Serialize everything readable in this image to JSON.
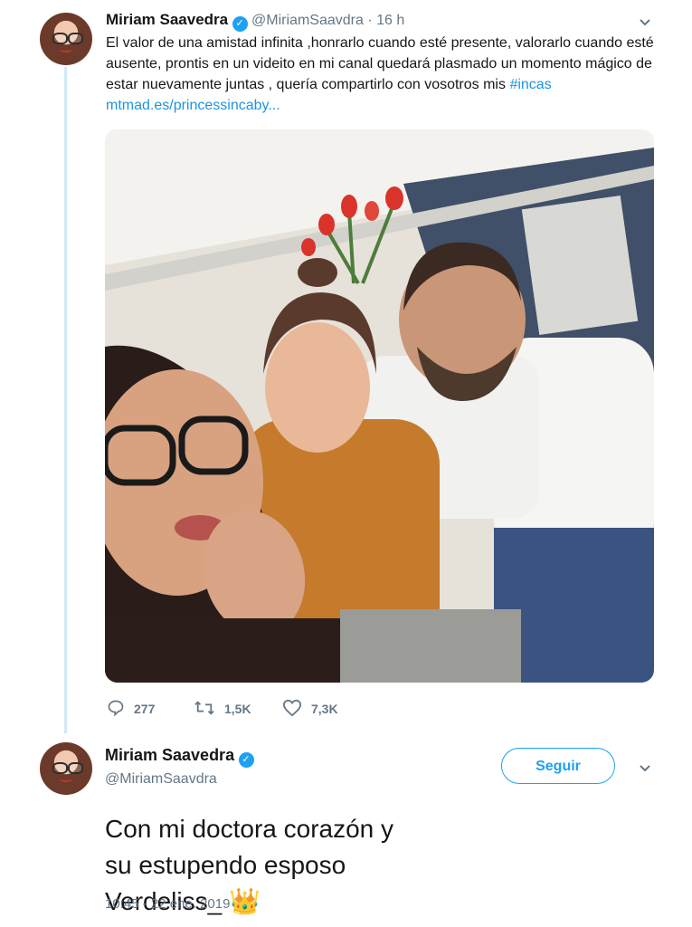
{
  "reply_tweet": {
    "name": "Miriam Saavedra",
    "handle_time": "@MiriamSaavdra · 16 h",
    "text_plain": "El valor de una amistad infinita ,honrarlo cuando esté presente, valorarlo cuando esté ausente, prontis en un videito en mi canal quedará plasmado un momento mágico de estar nuevamente juntas , quería compartirlo con vosotros mis ",
    "hashtag": "#incas",
    "link": "mtmad.es/princessincaby...",
    "replies": "277",
    "retweets": "1,5K",
    "likes": "7,3K"
  },
  "main_tweet": {
    "name": "Miriam Saavedra",
    "handle": "@MiriamSaavdra",
    "follow_label": "Seguir",
    "text": "Con mi doctora corazón y su estupendo esposo Verdeliss_",
    "emoji": "👑",
    "timestamp": "10:45 - 22 ene. 2019"
  },
  "colors": {
    "accent": "#1da1f2",
    "link": "#1b95e0",
    "muted": "#657786",
    "thread_line": "#cfe9f5"
  },
  "icons": [
    "verified-badge-icon",
    "chevron-down-icon",
    "reply-icon",
    "retweet-icon",
    "like-icon",
    "crown-icon"
  ]
}
